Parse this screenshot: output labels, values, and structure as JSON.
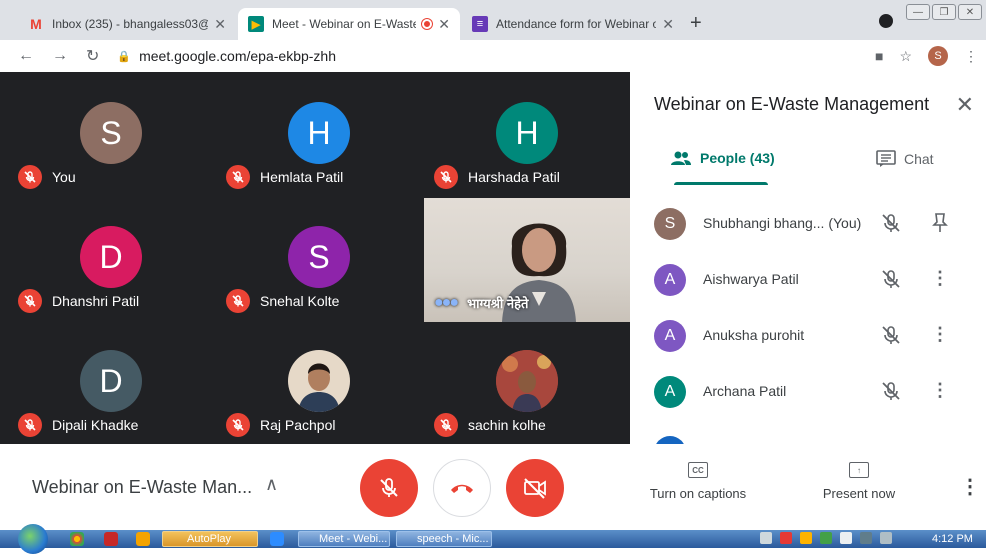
{
  "browser": {
    "tabs": [
      {
        "title": "Inbox (235) - bhangaless03@gm",
        "icon": "gmail-icon"
      },
      {
        "title": "Meet - Webinar on E-Waste",
        "icon": "meet-icon",
        "recording": true
      },
      {
        "title": "Attendance form for Webinar on",
        "icon": "forms-icon"
      }
    ],
    "url": "meet.google.com/epa-ekbp-zhh",
    "profile_initial": "S"
  },
  "grid": {
    "tiles": [
      {
        "initial": "S",
        "name": "You",
        "color": "#8d6e63"
      },
      {
        "initial": "H",
        "name": "Hemlata Patil",
        "color": "#1e88e5"
      },
      {
        "initial": "H",
        "name": "Harshada Patil",
        "color": "#00897b"
      },
      {
        "initial": "D",
        "name": "Dhanshri Patil",
        "color": "#d81b60"
      },
      {
        "initial": "S",
        "name": "Snehal Kolte",
        "color": "#8e24aa"
      },
      {
        "initial": "D",
        "name": "Dipali Khadke",
        "color": "#455a64"
      },
      {
        "initial": "",
        "name": "Raj Pachpol",
        "color": "#e0c8a8",
        "photo": true
      },
      {
        "initial": "",
        "name": "sachin kolhe",
        "color": "#9e3b3b",
        "photo": true
      }
    ],
    "speaker": {
      "name": "भाग्यश्री नेहेते"
    }
  },
  "panel": {
    "title": "Webinar on E-Waste Management",
    "people_tab": "People (43)",
    "chat_tab": "Chat",
    "people": [
      {
        "initial": "S",
        "name": "Shubhangi bhang... (You)",
        "color": "#8d6e63",
        "self": true
      },
      {
        "initial": "A",
        "name": "Aishwarya Patil",
        "color": "#7e57c2"
      },
      {
        "initial": "A",
        "name": "Anuksha purohit",
        "color": "#7e57c2"
      },
      {
        "initial": "A",
        "name": "Archana Patil",
        "color": "#00897b"
      }
    ]
  },
  "bottom": {
    "meeting_title": "Webinar on E-Waste Man...",
    "captions_label": "Turn on captions",
    "present_label": "Present now"
  },
  "taskbar": {
    "items": [
      {
        "label": "AutoPlay"
      },
      {
        "label": "Meet - Webi..."
      },
      {
        "label": "speech - Mic..."
      }
    ],
    "clock": "4:12 PM"
  }
}
